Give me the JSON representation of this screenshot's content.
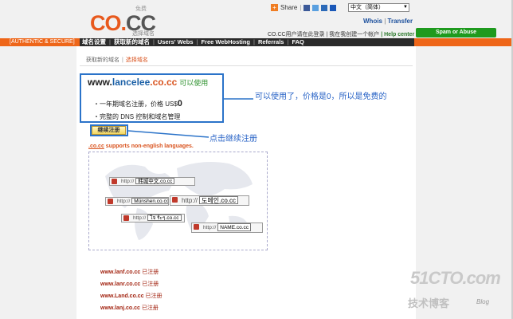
{
  "logo": {
    "text": "CO.",
    "suffix": "CC",
    "top_label": "免费",
    "sub_label": "选择域名"
  },
  "header": {
    "share_label": "Share",
    "language": "中文（简体）",
    "whois": "Whois",
    "sep": "|",
    "transfer": "Transfer",
    "login_text": "CO.CC用户请在此登录 | 我在我创建一个帐户",
    "help": "| Help center",
    "spam_button": "Spam or Abuse"
  },
  "menubar": {
    "auth_label": "[AUTHENTIC & SECURE]",
    "items": [
      "域名设置",
      "获取新的域名",
      "Users' Webs",
      "Free WebHosting",
      "Referrals",
      "FAQ"
    ],
    "sep": "|"
  },
  "breadcrumb": {
    "item1": "获取新的域名",
    "sep": "|",
    "item2": "选择域名"
  },
  "result": {
    "domain_prefix": "www.",
    "domain_name": "lancelee",
    "domain_tld": ".co.cc",
    "available": "可以使用",
    "bullet1": "・一年期域名注册，价格  US$",
    "price": "0",
    "bullet2": "・完整的  DNS 控制和域名管理",
    "continue_button": "继续注册"
  },
  "supports": {
    "u": ".co.cc",
    "rest": " supports non-english languages."
  },
  "map_fields": [
    {
      "prefix": "http://",
      "value": "韩城中文.co.cc"
    },
    {
      "prefix": "http://",
      "value": "Münshen.co.cc"
    },
    {
      "prefix": "http://",
      "value": "도메인.co.cc"
    },
    {
      "prefix": "http://",
      "value": "ใจ ร์ะๆ.co.cc"
    },
    {
      "prefix": "http://",
      "value": "NAME.co.cc"
    }
  ],
  "registered": [
    {
      "domain": "www.lanf.co.cc",
      "status": "已注册"
    },
    {
      "domain": "www.lanr.co.cc",
      "status": "已注册"
    },
    {
      "domain": "www.Land.co.cc",
      "status": "已注册"
    },
    {
      "domain": "www.lanj.co.cc",
      "status": "已注册"
    }
  ],
  "annotations": {
    "note1": "可以使用了，价格是0，所以是免费的",
    "note2": "点击继续注册"
  },
  "watermark": {
    "site": "51CTO.com",
    "label": "技术博客",
    "blog": "Blog"
  },
  "colors": {
    "brand_orange": "#ee6619",
    "annotation_blue": "#2b73c9",
    "spam_green": "#1e9a1e"
  },
  "icons": {
    "share": "plus-icon",
    "world_map": "world-map-image"
  }
}
